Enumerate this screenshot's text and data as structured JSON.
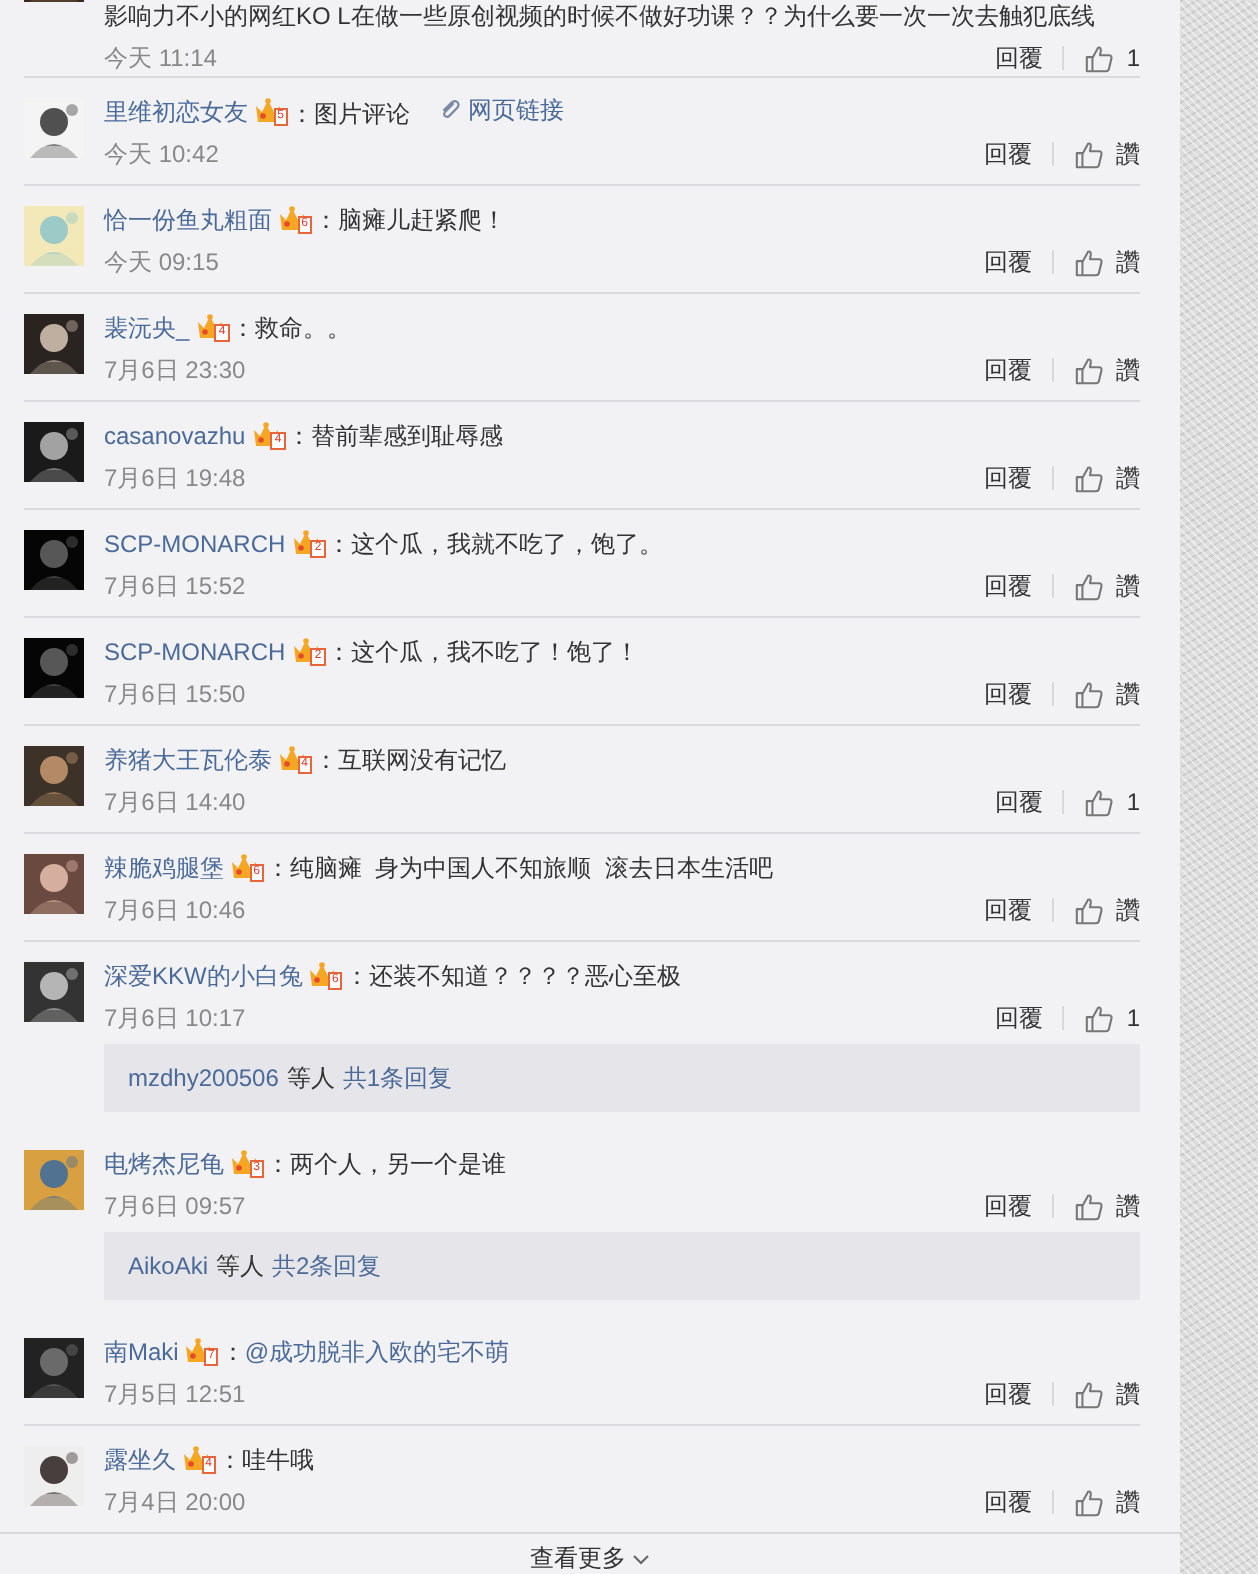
{
  "comments": [
    {
      "segments": [
        {
          "kind": "text",
          "text": "影响力不小的网红KO L在做一些原创视频的时候不做好功课？？为什么要一次一次去触犯底线"
        }
      ],
      "time": "今天 11:14",
      "reply_label": "回覆",
      "like_label": "1"
    },
    {
      "user": "里维初恋女友",
      "level": "5",
      "segments": [
        {
          "kind": "text",
          "text": "：图片评论"
        },
        {
          "kind": "link",
          "text": "网页链接"
        }
      ],
      "time": "今天 10:42",
      "reply_label": "回覆",
      "like_label": "讚"
    },
    {
      "user": "恰一份鱼丸粗面",
      "level": "6",
      "segments": [
        {
          "kind": "text",
          "text": "：脑瘫儿赶紧爬！"
        }
      ],
      "time": "今天 09:15",
      "reply_label": "回覆",
      "like_label": "讚"
    },
    {
      "user": "裴沅央_",
      "level": "4",
      "segments": [
        {
          "kind": "text",
          "text": "：救命。。"
        }
      ],
      "time": "7月6日 23:30",
      "reply_label": "回覆",
      "like_label": "讚"
    },
    {
      "user": "casanovazhu",
      "level": "4",
      "segments": [
        {
          "kind": "text",
          "text": "：替前辈感到耻辱感"
        }
      ],
      "time": "7月6日 19:48",
      "reply_label": "回覆",
      "like_label": "讚"
    },
    {
      "user": "SCP-MONARCH",
      "level": "2",
      "segments": [
        {
          "kind": "text",
          "text": "：这个瓜，我就不吃了，饱了。"
        }
      ],
      "time": "7月6日 15:52",
      "reply_label": "回覆",
      "like_label": "讚"
    },
    {
      "user": "SCP-MONARCH",
      "level": "2",
      "segments": [
        {
          "kind": "text",
          "text": "：这个瓜，我不吃了！饱了！"
        }
      ],
      "time": "7月6日 15:50",
      "reply_label": "回覆",
      "like_label": "讚"
    },
    {
      "user": "养猪大王瓦伦泰",
      "level": "4",
      "segments": [
        {
          "kind": "text",
          "text": "：互联网没有记忆"
        }
      ],
      "time": "7月6日 14:40",
      "reply_label": "回覆",
      "like_label": "1"
    },
    {
      "user": "辣脆鸡腿堡",
      "level": "6",
      "segments": [
        {
          "kind": "text",
          "text": "：纯脑瘫  身为中国人不知旅顺  滚去日本生活吧"
        }
      ],
      "time": "7月6日 10:46",
      "reply_label": "回覆",
      "like_label": "讚"
    },
    {
      "user": "深爱KKW的小白兔",
      "level": "6",
      "segments": [
        {
          "kind": "text",
          "text": "：还装不知道？？？？恶心至极"
        }
      ],
      "time": "7月6日 10:17",
      "reply_label": "回覆",
      "like_label": "1",
      "replies": {
        "users": "mzdhy200506",
        "middle": "等人",
        "count": "共1条回复"
      }
    },
    {
      "user": "电烤杰尼龟",
      "level": "3",
      "segments": [
        {
          "kind": "text",
          "text": "：两个人，另一个是谁"
        }
      ],
      "time": "7月6日 09:57",
      "reply_label": "回覆",
      "like_label": "讚",
      "replies": {
        "users": "AikoAki",
        "middle": "等人",
        "count": "共2条回复"
      }
    },
    {
      "user": "南Maki",
      "level": "7",
      "segments": [
        {
          "kind": "text",
          "text": "："
        },
        {
          "kind": "mention",
          "text": "@成功脱非入欧的宅不萌"
        }
      ],
      "time": "7月5日 12:51",
      "reply_label": "回覆",
      "like_label": "讚"
    },
    {
      "user": "露坐久",
      "level": "4",
      "segments": [
        {
          "kind": "text",
          "text": "：哇牛哦"
        }
      ],
      "time": "7月4日 20:00",
      "reply_label": "回覆",
      "like_label": "讚"
    }
  ],
  "more": {
    "label": "查看更多"
  }
}
